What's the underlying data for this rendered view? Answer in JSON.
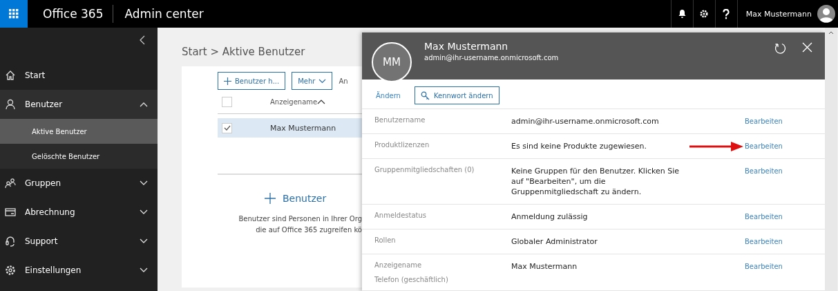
{
  "topbar": {
    "product": "Office 365",
    "app": "Admin center",
    "user": "Max Mustermann"
  },
  "sidebar": {
    "items": [
      {
        "label": "Start",
        "selected": false
      },
      {
        "label": "Benutzer",
        "expanded": true,
        "selected": false,
        "children": [
          {
            "label": "Aktive Benutzer",
            "selected": true
          },
          {
            "label": "Gelöschte Benutzer",
            "selected": false
          }
        ]
      },
      {
        "label": "Gruppen",
        "expanded": false,
        "selected": false
      },
      {
        "label": "Abrechnung",
        "expanded": false,
        "selected": false
      },
      {
        "label": "Support",
        "expanded": false,
        "selected": false
      },
      {
        "label": "Einstellungen",
        "expanded": false,
        "selected": false
      }
    ]
  },
  "breadcrumb": "Start > Aktive Benutzer",
  "toolbar": {
    "add": "Benutzer h...",
    "more": "Mehr",
    "column_3": "An"
  },
  "table": {
    "header": "Anzeigename",
    "all_selected": false,
    "rows": [
      {
        "name": "Max Mustermann",
        "selected": true
      }
    ]
  },
  "empty": {
    "action": "Benutzer",
    "text_lines": [
      "Benutzer sind Personen in Ihrer Org",
      "die auf Office 365 zugreifen kö"
    ]
  },
  "panel": {
    "initials": "MM",
    "name": "Max Mustermann",
    "email": "admin@ihr-username.onmicrosoft.com",
    "change": "Ändern",
    "password": "Kennwort ändern",
    "rows": [
      {
        "label": "Benutzername",
        "value": "admin@ihr-username.onmicrosoft.com",
        "link": "Bearbeiten",
        "arrow": false
      },
      {
        "label": "Produktlizenzen",
        "value": "Es sind keine Produkte zugewiesen.",
        "link": "Bearbeiten",
        "arrow": true
      },
      {
        "label": "Gruppenmitgliedschaften (0)",
        "value": "Keine Gruppen für den Benutzer. Klicken Sie auf \"Bearbeiten\", um die Gruppenmitgliedschaft zu ändern.",
        "link": "Bearbeiten",
        "arrow": false
      },
      {
        "label": "Anmeldestatus",
        "value": "Anmeldung zulässig",
        "link": "Bearbeiten",
        "arrow": false
      },
      {
        "label": "Rollen",
        "value": "Globaler Administrator",
        "link": "Bearbeiten",
        "arrow": false
      },
      {
        "label": "Anzeigename",
        "sublabel": "Telefon (geschäftlich)",
        "value": "Max Mustermann",
        "link": "Bearbeiten",
        "arrow": false
      }
    ]
  }
}
